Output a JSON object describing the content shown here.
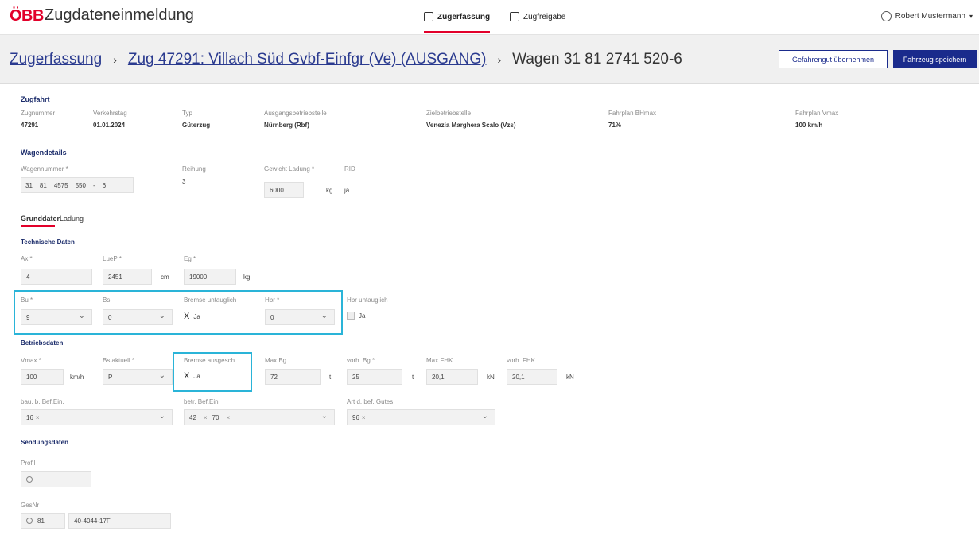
{
  "header": {
    "logo": "ÖBB",
    "title": "Zugdateneinmeldung",
    "nav": [
      {
        "label": "Zugerfassung",
        "icon": "train-icon"
      },
      {
        "label": "Zugfreigabe",
        "icon": "release-icon"
      }
    ],
    "user": "Robert Mustermann"
  },
  "breadcrumb": {
    "item1": "Zugerfassung",
    "item2": "Zug 47291: Villach Süd Gvbf-Einfgr (Ve) (AUSGANG)",
    "item3": "Wagen 31 81 2741 520-6",
    "sep": "›"
  },
  "actions": {
    "gefahrgut": "Gefahrengut übernehmen",
    "save": "Fahrzeug speichern"
  },
  "zugfahrt": {
    "title": "Zugfahrt",
    "fields": [
      {
        "label": "Zugnummer",
        "value": "47291"
      },
      {
        "label": "Verkehrstag",
        "value": "01.01.2024"
      },
      {
        "label": "Typ",
        "value": "Güterzug"
      },
      {
        "label": "Ausgangsbetriebstelle",
        "value": "Nürnberg (Rbf)"
      },
      {
        "label": "Zielbetriebstelle",
        "value": "Venezia Marghera Scalo (Vzs)"
      },
      {
        "label": "Fahrplan BHmax",
        "value": "71%"
      },
      {
        "label": "Fahrplan Vmax",
        "value": "100 km/h"
      }
    ]
  },
  "wagendetails": {
    "title": "Wagendetails",
    "wagennummer_label": "Wagennummer *",
    "wagennummer_parts": [
      "31",
      "81",
      "4575",
      "550",
      "-",
      "6"
    ],
    "reihung_label": "Reihung",
    "reihung_value": "3",
    "gewicht_label": "Gewicht Ladung *",
    "gewicht_value": "6000",
    "gewicht_unit": "kg",
    "rid_label": "RID",
    "rid_value": "ja"
  },
  "tabs": {
    "grunddaten": "Grunddaten",
    "ladung": "Ladung"
  },
  "technische": {
    "title": "Technische Daten",
    "ax_label": "Ax *",
    "ax_value": "4",
    "luep_label": "LueP *",
    "luep_value": "2451",
    "luep_unit": "cm",
    "eg_label": "Eg *",
    "eg_value": "19000",
    "eg_unit": "kg",
    "bu_label": "Bu *",
    "bu_value": "9",
    "bs_label": "Bs",
    "bs_value": "0",
    "bremse_label": "Bremse untauglich",
    "bremse_value": "Ja",
    "bremse_mark": "X",
    "hbr_label": "Hbr *",
    "hbr_value": "0",
    "hbr_untauglich_label": "Hbr untauglich",
    "hbr_untauglich_value": "Ja"
  },
  "betrieb": {
    "title": "Betriebsdaten",
    "vmax_label": "Vmax *",
    "vmax_value": "100",
    "vmax_unit": "km/h",
    "bsakt_label": "Bs aktuell *",
    "bsakt_value": "P",
    "bremse_aus_label": "Bremse ausgesch.",
    "bremse_aus_value": "Ja",
    "bremse_aus_mark": "X",
    "maxbg_label": "Max Bg",
    "maxbg_value": "72",
    "maxbg_unit": "t",
    "vorhbg_label": "vorh. Bg *",
    "vorhbg_value": "25",
    "vorhbg_unit": "t",
    "maxfhk_label": "Max FHK",
    "maxfhk_value": "20,1",
    "maxfhk_unit": "kN",
    "vorhfhk_label": "vorh. FHK",
    "vorhfhk_value": "20,1",
    "vorhfhk_unit": "kN",
    "bau_label": "bau. b. Bef.Ein.",
    "bau_chip": "16",
    "betr_label": "betr. Bef.Ein",
    "betr_chip1": "42",
    "betr_chip2": "70",
    "art_label": "Art d. bef. Gutes",
    "art_chip": "96",
    "chip_x": "×"
  },
  "sendung": {
    "title": "Sendungsdaten",
    "profil_label": "Profil",
    "gesnr_label": "GesNr",
    "gesnr_prefix": "81",
    "gesnr_value": "40-4044-17F"
  },
  "colors": {
    "brand_red": "#e2002a",
    "primary_blue": "#1a2b8c",
    "highlight": "#2ab4d8"
  }
}
